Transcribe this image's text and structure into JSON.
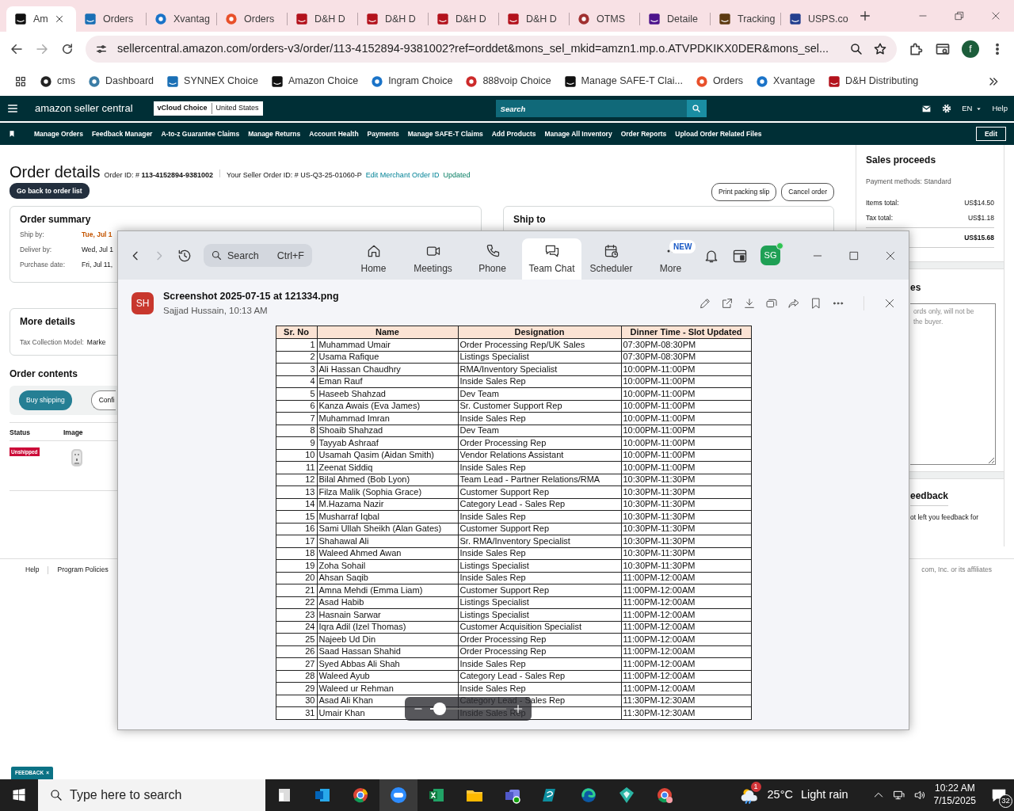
{
  "browser": {
    "tabs": [
      {
        "title": "Am",
        "selected": true
      },
      {
        "title": "Orders",
        "selected": false
      },
      {
        "title": "Xvantag",
        "selected": false
      },
      {
        "title": "Orders",
        "selected": false
      },
      {
        "title": "D&H D",
        "selected": false
      },
      {
        "title": "D&H D",
        "selected": false
      },
      {
        "title": "D&H D",
        "selected": false
      },
      {
        "title": "D&H D",
        "selected": false
      },
      {
        "title": "OTMS",
        "selected": false
      },
      {
        "title": "Detaile",
        "selected": false
      },
      {
        "title": "Tracking",
        "selected": false
      },
      {
        "title": "USPS.co",
        "selected": false
      }
    ],
    "address": "sellercentral.amazon.com/orders-v3/order/113-4152894-9381002?ref=orddet&mons_sel_mkid=amzn1.mp.o.ATVPDKIKX0DER&mons_sel...",
    "profile": "f",
    "bookmarks": [
      "cms",
      "Dashboard",
      "SYNNEX Choice",
      "Amazon Choice",
      "Ingram Choice",
      "888voip Choice",
      "Manage SAFE-T Clai...",
      "Orders",
      "Xvantage",
      "D&H Distributing"
    ]
  },
  "seller_header": {
    "logo": "amazon seller central",
    "store": "vCloud Choice",
    "marketplace": "United States",
    "search": {
      "placeholder": "Search"
    },
    "language": "EN",
    "help": "Help"
  },
  "nav": {
    "items": [
      "Manage Orders",
      "Feedback Manager",
      "A-to-z Guarantee Claims",
      "Manage Returns",
      "Account Health",
      "Payments",
      "Manage SAFE-T Claims",
      "Add Products",
      "Manage All Inventory",
      "Order Reports",
      "Upload Order Related Files"
    ],
    "edit": "Edit"
  },
  "order": {
    "title": "Order details",
    "order_id": "Order ID: # **113-4152894-9381002**",
    "seller_order_id": "Your Seller Order ID: # US-Q3-25-01060-P",
    "edit_link": "Edit Merchant Order ID",
    "updated": "Updated",
    "back_button": "Go back to order list",
    "actions": [
      "Print packing slip",
      "Cancel order"
    ]
  },
  "order_summary": {
    "title": "Order summary",
    "rows": [
      {
        "label": "Ship by:",
        "value": "Tue, Jul 1",
        "kind": "highlight"
      },
      {
        "label": "Deliver by:",
        "value": "Wed, Jul 1",
        "kind": "plain"
      },
      {
        "label": "Purchase date:",
        "value": "Fri, Jul 11,",
        "kind": "plain"
      }
    ]
  },
  "ship_to": {
    "title": "Ship to"
  },
  "more_details": {
    "title": "More details",
    "label": "Tax Collection Model:",
    "value": "Marke"
  },
  "order_contents": {
    "title": "Order contents",
    "buttons": [
      {
        "label": "Buy shipping",
        "kind": "primary"
      },
      {
        "label": "Confi",
        "kind": "outline"
      }
    ],
    "columns": [
      "Status",
      "Image"
    ],
    "rows": [
      {
        "status": "Unshipped"
      }
    ]
  },
  "sales_proceeds": {
    "title": "Sales proceeds",
    "payment": "Payment methods: Standard",
    "lines": [
      {
        "label": "Items total:",
        "value": "US$14.50"
      },
      {
        "label": "Tax total:",
        "value": "US$1.18"
      }
    ],
    "total": "US$15.68"
  },
  "notes": {
    "title": "es",
    "placeholder": "ords only, will not be\nthe buyer."
  },
  "feedback": {
    "title": "eedback",
    "text": "ot left you feedback for"
  },
  "footer": {
    "links": [
      "Help",
      "Program Policies"
    ],
    "copyright": "com, Inc. or its affiliates"
  },
  "feedback_tab": {
    "label": "FEEDBACK",
    "close": "×"
  },
  "zoom_window": {
    "search": {
      "placeholder": "Search",
      "shortcut": "Ctrl+F"
    },
    "tabs": [
      {
        "label": "Home",
        "selected": false
      },
      {
        "label": "Meetings",
        "selected": false
      },
      {
        "label": "Phone",
        "selected": false
      },
      {
        "label": "Team Chat",
        "selected": true
      },
      {
        "label": "Scheduler",
        "selected": false
      },
      {
        "label": "More",
        "selected": false,
        "badge": "NEW"
      }
    ],
    "avatar": "SG",
    "online": true,
    "viewer": {
      "avatar": "SH",
      "title": "Screenshot 2025-07-15 at 121334.png",
      "subtitle": "Sajjad Hussain, 10:13 AM",
      "table": {
        "columns": [
          "Sr. No",
          "Name",
          "Designation",
          "Dinner Time - Slot Updated"
        ],
        "rows": [
          [
            "1",
            "Muhammad Umair",
            "Order Processing Rep/UK Sales",
            "07:30PM-08:30PM"
          ],
          [
            "2",
            "Usama Rafique",
            "Listings Specialist",
            "07:30PM-08:30PM"
          ],
          [
            "3",
            "Ali Hassan Chaudhry",
            "RMA/Inventory Specialist",
            "10:00PM-11:00PM"
          ],
          [
            "4",
            "Eman Rauf",
            "Inside Sales Rep",
            "10:00PM-11:00PM"
          ],
          [
            "5",
            "Haseeb Shahzad",
            "Dev Team",
            "10:00PM-11:00PM"
          ],
          [
            "6",
            "Kanza Awais (Eva James)",
            "Sr. Customer Support Rep",
            "10:00PM-11:00PM"
          ],
          [
            "7",
            "Muhammad Imran",
            "Inside Sales Rep",
            "10:00PM-11:00PM"
          ],
          [
            "8",
            "Shoaib Shahzad",
            "Dev Team",
            "10:00PM-11:00PM"
          ],
          [
            "9",
            "Tayyab Ashraaf",
            "Order Processing Rep",
            "10:00PM-11:00PM"
          ],
          [
            "10",
            "Usamah Qasim (Aidan Smith)",
            "Vendor Relations Assistant",
            "10:00PM-11:00PM"
          ],
          [
            "11",
            "Zeenat Siddiq",
            "Inside Sales Rep",
            "10:00PM-11:00PM"
          ],
          [
            "12",
            "Bilal Ahmed (Bob Lyon)",
            "Team Lead - Partner Relations/RMA",
            "10:30PM-11:30PM"
          ],
          [
            "13",
            "Filza Malik (Sophia Grace)",
            "Customer Support Rep",
            "10:30PM-11:30PM"
          ],
          [
            "14",
            "M.Hazama Nazir",
            "Category Lead - Sales Rep",
            "10:30PM-11:30PM"
          ],
          [
            "15",
            "Musharraf Iqbal",
            "Inside Sales Rep",
            "10:30PM-11:30PM"
          ],
          [
            "16",
            "Sami Ullah Sheikh (Alan Gates)",
            "Customer Support Rep",
            "10:30PM-11:30PM"
          ],
          [
            "17",
            "Shahawal Ali",
            "Sr. RMA/Inventory Specialist",
            "10:30PM-11:30PM"
          ],
          [
            "18",
            "Waleed Ahmed Awan",
            "Inside Sales Rep",
            "10:30PM-11:30PM"
          ],
          [
            "19",
            "Zoha Sohail",
            "Listings Specialist",
            "10:30PM-11:30PM"
          ],
          [
            "20",
            "Ahsan Saqib",
            "Inside Sales Rep",
            "11:00PM-12:00AM"
          ],
          [
            "21",
            "Amna Mehdi (Emma Liam)",
            "Customer Support Rep",
            "11:00PM-12:00AM"
          ],
          [
            "22",
            "Asad Habib",
            "Listings Specialist",
            "11:00PM-12:00AM"
          ],
          [
            "23",
            "Hasnain Sarwar",
            "Listings Specialist",
            "11:00PM-12:00AM"
          ],
          [
            "24",
            "Iqra Adil (Izel Thomas)",
            "Customer Acquisition Specialist",
            "11:00PM-12:00AM"
          ],
          [
            "25",
            "Najeeb Ud Din",
            "Order Processing Rep",
            "11:00PM-12:00AM"
          ],
          [
            "26",
            "Saad Hassan Shahid",
            "Order Processing Rep",
            "11:00PM-12:00AM"
          ],
          [
            "27",
            "Syed Abbas Ali Shah",
            "Inside Sales Rep",
            "11:00PM-12:00AM"
          ],
          [
            "28",
            "Waleed Ayub",
            "Category Lead - Sales Rep",
            "11:00PM-12:00AM"
          ],
          [
            "29",
            "Waleed ur Rehman",
            "Inside Sales Rep",
            "11:00PM-12:00AM"
          ],
          [
            "30",
            "Asad Ali Khan",
            "Category Lead - Sales Rep",
            "11:30PM-12:30AM"
          ],
          [
            "31",
            "Umair Khan",
            "Inside Sales Rep",
            "11:30PM-12:30AM"
          ]
        ]
      },
      "zoom": {
        "level": 0.12
      }
    }
  },
  "taskbar": {
    "search": {
      "placeholder": "Type here to search"
    },
    "apps": [
      {
        "selected": false
      },
      {
        "selected": false
      },
      {
        "selected": false
      },
      {
        "selected": true
      },
      {
        "selected": false
      },
      {
        "selected": false
      },
      {
        "selected": false
      },
      {
        "selected": false
      },
      {
        "selected": false
      },
      {
        "selected": false
      },
      {
        "selected": false
      }
    ],
    "weather_alert": "1",
    "temperature": "25°C",
    "weather": "Light rain",
    "time": "10:22 AM",
    "date": "7/15/2025",
    "notifications": "32"
  }
}
